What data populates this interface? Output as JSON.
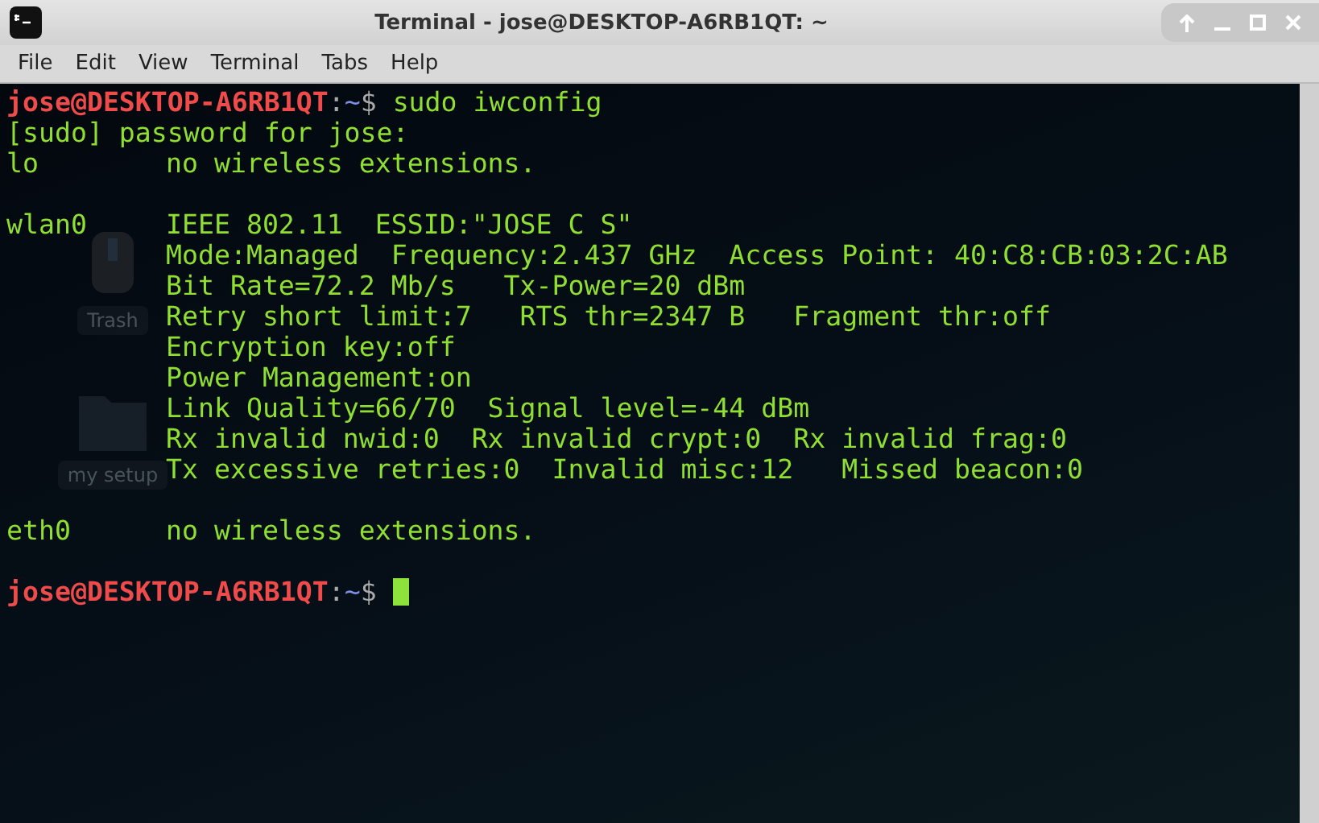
{
  "window": {
    "title": "Terminal - jose@DESKTOP-A6RB1QT: ~"
  },
  "menu": [
    "File",
    "Edit",
    "View",
    "Terminal",
    "Tabs",
    "Help"
  ],
  "desktop_icons": [
    {
      "kind": "trash",
      "label": "Trash"
    },
    {
      "kind": "folder",
      "label": "my setup"
    }
  ],
  "lines": [
    {
      "kind": "prompt",
      "user_host": "jose@DESKTOP-A6RB1QT",
      "separator": ":",
      "path": "~",
      "symbol": "$",
      "command": "sudo iwconfig",
      "cursor": false
    },
    {
      "kind": "output",
      "text": "[sudo] password for jose:"
    },
    {
      "kind": "output",
      "interface": "lo",
      "text": "no wireless extensions."
    },
    {
      "kind": "blank"
    },
    {
      "kind": "output",
      "interface": "wlan0",
      "text": "IEEE 802.11  ESSID:\"JOSE C S\""
    },
    {
      "kind": "detail",
      "text": "Mode:Managed  Frequency:2.437 GHz  Access Point: 40:C8:CB:03:2C:AB"
    },
    {
      "kind": "detail",
      "text": "Bit Rate=72.2 Mb/s   Tx-Power=20 dBm"
    },
    {
      "kind": "detail",
      "text": "Retry short limit:7   RTS thr=2347 B   Fragment thr:off"
    },
    {
      "kind": "detail",
      "text": "Encryption key:off"
    },
    {
      "kind": "detail",
      "text": "Power Management:on"
    },
    {
      "kind": "detail",
      "text": "Link Quality=66/70  Signal level=-44 dBm"
    },
    {
      "kind": "detail",
      "text": "Rx invalid nwid:0  Rx invalid crypt:0  Rx invalid frag:0"
    },
    {
      "kind": "detail",
      "text": "Tx excessive retries:0  Invalid misc:12   Missed beacon:0"
    },
    {
      "kind": "blank"
    },
    {
      "kind": "output",
      "interface": "eth0",
      "text": "no wireless extensions."
    },
    {
      "kind": "blank"
    },
    {
      "kind": "prompt",
      "user_host": "jose@DESKTOP-A6RB1QT",
      "separator": ":",
      "path": "~",
      "symbol": "$",
      "cursor": true
    }
  ]
}
